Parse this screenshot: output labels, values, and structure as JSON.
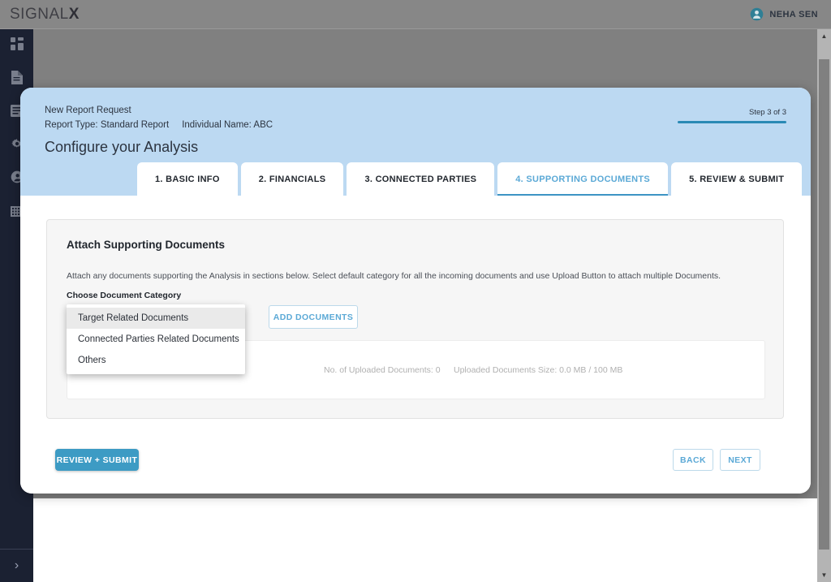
{
  "app": {
    "logo_main": "SIGNAL",
    "logo_accent": "X",
    "user_name": "NEHA SEN",
    "avatar_icon": "account-circle-icon"
  },
  "sidebar": {
    "items": [
      {
        "icon": "dashboard-grid-icon",
        "name": "sidebar-item-dashboard"
      },
      {
        "icon": "document-icon",
        "name": "sidebar-item-reports"
      },
      {
        "icon": "list-icon",
        "name": "sidebar-item-list"
      },
      {
        "icon": "gear-icon",
        "name": "sidebar-item-settings"
      },
      {
        "icon": "account-icon",
        "name": "sidebar-item-account"
      },
      {
        "icon": "building-icon",
        "name": "sidebar-item-organization"
      }
    ],
    "expand_label": "›"
  },
  "modal": {
    "eyebrow": "New Report Request",
    "report_type": "Report Type: Standard Report",
    "individual_name": "Individual Name: ABC",
    "title": "Configure your Analysis",
    "step_label": "Step 3 of 3",
    "step_progress_percent": 100,
    "tabs": [
      {
        "label": "1. BASIC INFO",
        "active": false
      },
      {
        "label": "2. FINANCIALS",
        "active": false
      },
      {
        "label": "3. CONNECTED PARTIES",
        "active": false
      },
      {
        "label": "4. SUPPORTING DOCUMENTS",
        "active": true
      },
      {
        "label": "5. REVIEW & SUBMIT",
        "active": false
      }
    ]
  },
  "card": {
    "title": "Attach Supporting Documents",
    "description": "Attach any documents supporting the Analysis in sections below. Select default category for all the incoming documents and use Upload Button to attach multiple Documents.",
    "category_label": "Choose Document Category",
    "category_value": "",
    "category_options": [
      {
        "label": "Target Related Documents",
        "highlighted": true
      },
      {
        "label": "Connected Parties Related Documents",
        "highlighted": false
      },
      {
        "label": "Others",
        "highlighted": false
      }
    ],
    "add_documents_label": "ADD DOCUMENTS",
    "uploaded_count_text": "No. of Uploaded Documents: 0",
    "uploaded_size_text": "Uploaded Documents Size: 0.0 MB / 100 MB"
  },
  "footer": {
    "review_submit_label": "REVIEW + SUBMIT",
    "back_label": "BACK",
    "next_label": "NEXT"
  },
  "scrollbar": {
    "up_arrow": "▲",
    "down_arrow": "▼"
  },
  "colors": {
    "accent_blue": "#3d9bc4",
    "tab_active": "#5ba9d6",
    "header_bg": "#bcd9f2",
    "sidebar_bg": "#1b2132"
  }
}
